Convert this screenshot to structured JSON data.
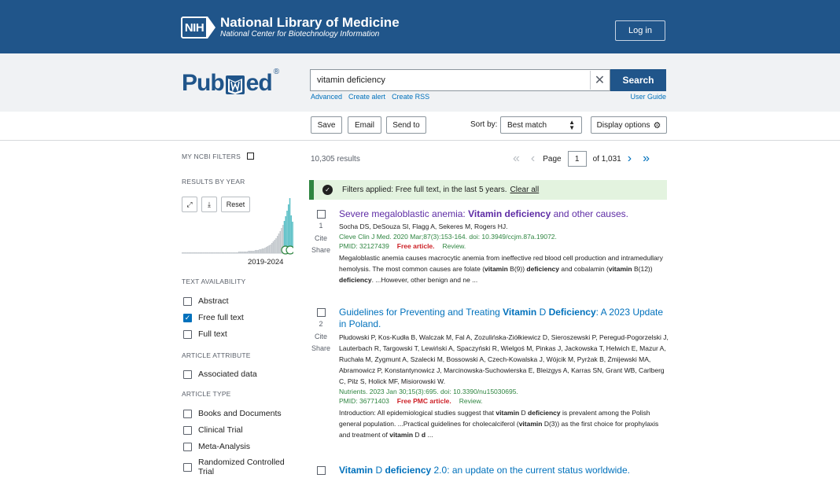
{
  "header": {
    "nih_badge": "NIH",
    "org_name": "National Library of Medicine",
    "org_sub": "National Center for Biotechnology Information",
    "login": "Log in"
  },
  "search": {
    "logo_left": "Pub",
    "logo_right": "ed",
    "logo_reg": "®",
    "query": "vitamin deficiency",
    "button": "Search",
    "links": [
      "Advanced",
      "Create alert",
      "Create RSS"
    ],
    "user_guide": "User Guide"
  },
  "actions": {
    "save": "Save",
    "email": "Email",
    "send_to": "Send to",
    "sort_by_label": "Sort by:",
    "sort_value": "Best match",
    "display_options": "Display options"
  },
  "sidebar": {
    "my_filters": "MY NCBI FILTERS",
    "results_by_year": "RESULTS BY YEAR",
    "reset": "Reset",
    "year_range": "2019-2024",
    "text_availability": "TEXT AVAILABILITY",
    "text_filters": [
      {
        "label": "Abstract",
        "checked": false
      },
      {
        "label": "Free full text",
        "checked": true
      },
      {
        "label": "Full text",
        "checked": false
      }
    ],
    "article_attribute": "ARTICLE ATTRIBUTE",
    "attribute_filters": [
      {
        "label": "Associated data",
        "checked": false
      }
    ],
    "article_type": "ARTICLE TYPE",
    "type_filters": [
      {
        "label": "Books and Documents",
        "checked": false
      },
      {
        "label": "Clinical Trial",
        "checked": false
      },
      {
        "label": "Meta-Analysis",
        "checked": false
      },
      {
        "label": "Randomized Controlled Trial",
        "checked": false
      }
    ]
  },
  "results": {
    "count": "10,305 results",
    "page_label": "Page",
    "page_value": "1",
    "page_total": "of 1,031",
    "filters_banner": "Filters applied: Free full text, in the last 5 years.",
    "clear_all": "Clear all",
    "cite_label": "Cite",
    "share_label": "Share",
    "items": [
      {
        "num": "1",
        "title_a": "Severe megaloblastic anemia: ",
        "title_b": "Vitamin deficiency",
        "title_c": " and other causes.",
        "authors": "Socha DS, DeSouza SI, Flagg A, Sekeres M, Rogers HJ.",
        "citation": "Cleve Clin J Med. 2020 Mar;87(3):153-164. doi: 10.3949/ccjm.87a.19072.",
        "pmid": "PMID: 32127439",
        "free": "Free article.",
        "review": "Review.",
        "snippet_1": "Megaloblastic anemia causes macrocytic anemia from ineffective red blood cell production and intramedullary hemolysis. The most common causes are folate (",
        "snippet_b1": "vitamin",
        "snippet_2": " B(9)) ",
        "snippet_b2": "deficiency",
        "snippet_3": " and cobalamin (",
        "snippet_b3": "vitamin",
        "snippet_4": " B(12)) ",
        "snippet_b4": "deficiency",
        "snippet_5": ". ...However, other benign and ne ..."
      },
      {
        "num": "2",
        "title_a": "Guidelines for Preventing and Treating ",
        "title_b": "Vitamin",
        "title_c": " D ",
        "title_d": "Deficiency",
        "title_e": ": A 2023 Update in Poland.",
        "authors": "Płudowski P, Kos-Kudła B, Walczak M, Fal A, Zozulińska-Ziółkiewicz D, Sieroszewski P, Peregud-Pogorzelski J, Lauterbach R, Targowski T, Lewiński A, Spaczyński R, Wielgoś M, Pinkas J, Jackowska T, Helwich E, Mazur A, Ruchała M, Zygmunt A, Szalecki M, Bossowski A, Czech-Kowalska J, Wójcik M, Pyrżak B, Żmijewski MA, Abramowicz P, Konstantynowicz J, Marcinowska-Suchowierska E, Bleizgys A, Karras SN, Grant WB, Carlberg C, Pilz S, Holick MF, Misiorowski W.",
        "citation": "Nutrients. 2023 Jan 30;15(3):695. doi: 10.3390/nu15030695.",
        "pmid": "PMID: 36771403",
        "free": "Free PMC article.",
        "review": "Review.",
        "snippet_1": "Introduction: All epidemiological studies suggest that ",
        "snippet_b1": "vitamin",
        "snippet_2": " D ",
        "snippet_b2": "deficiency",
        "snippet_3": " is prevalent among the Polish general population. ...Practical guidelines for cholecalciferol (",
        "snippet_b3": "vitamin",
        "snippet_4": " D(3)) as the first choice for prophylaxis and treatment of ",
        "snippet_b4": "vitamin",
        "snippet_5": " D ",
        "snippet_b5": "d",
        "snippet_6": " ..."
      },
      {
        "title_a": "Vitamin",
        "title_b": " D ",
        "title_c": "deficiency",
        "title_d": " 2.0: an update on the current status worldwide."
      }
    ]
  },
  "histogram": {
    "bars": [
      1,
      1,
      1,
      1,
      1,
      1,
      1,
      1,
      1,
      1,
      1,
      1,
      1,
      1,
      1,
      1,
      1,
      1,
      1,
      1,
      1,
      1,
      1,
      1,
      1,
      1,
      1,
      1,
      1,
      1,
      1,
      1,
      1,
      1,
      1,
      1,
      1,
      1,
      1,
      1,
      1,
      2,
      2,
      2,
      2,
      2,
      2,
      2,
      3,
      3,
      3,
      3,
      3,
      4,
      4,
      4,
      5,
      5,
      6,
      6,
      7,
      8,
      9,
      10,
      11,
      13,
      15,
      17,
      19,
      22,
      25,
      28,
      32,
      36,
      41,
      47,
      54,
      62,
      70,
      48,
      40
    ],
    "highlight_from": 74,
    "bar_color": "#c2c7cc",
    "highlight_color": "#5abfc6"
  }
}
